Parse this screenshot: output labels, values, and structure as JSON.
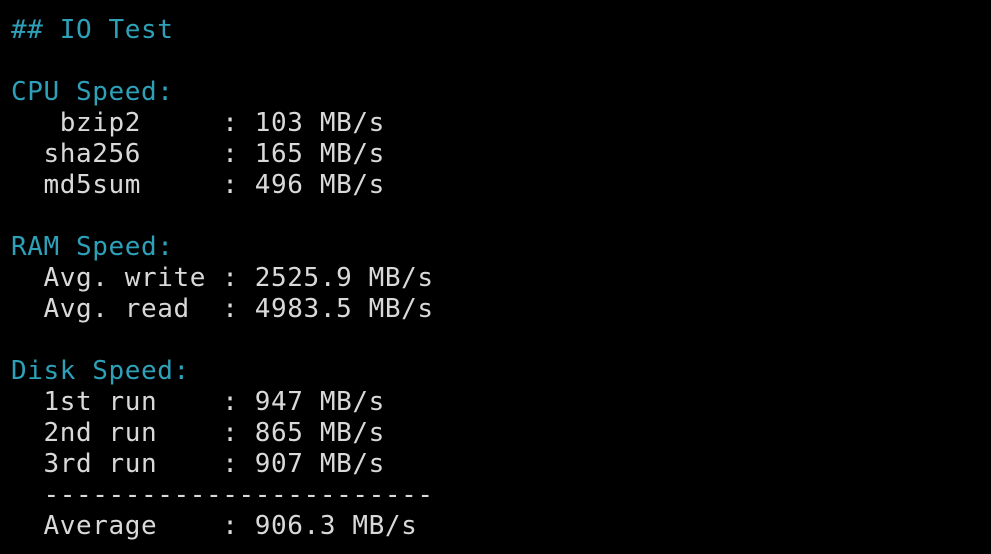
{
  "title": "## IO Test",
  "colors": {
    "background": "#000000",
    "heading": "#2ea0b8",
    "text": "#d9d9d9"
  },
  "cpu": {
    "heading": "CPU Speed:",
    "rows": [
      {
        "text": "   bzip2     : 103 MB/s"
      },
      {
        "text": "  sha256     : 165 MB/s"
      },
      {
        "text": "  md5sum     : 496 MB/s"
      }
    ]
  },
  "ram": {
    "heading": "RAM Speed:",
    "rows": [
      {
        "text": "  Avg. write : 2525.9 MB/s"
      },
      {
        "text": "  Avg. read  : 4983.5 MB/s"
      }
    ]
  },
  "disk": {
    "heading": "Disk Speed:",
    "rows": [
      {
        "text": "  1st run    : 947 MB/s"
      },
      {
        "text": "  2nd run    : 865 MB/s"
      },
      {
        "text": "  3rd run    : 907 MB/s"
      }
    ],
    "divider": "  ------------------------",
    "average": "  Average    : 906.3 MB/s"
  }
}
